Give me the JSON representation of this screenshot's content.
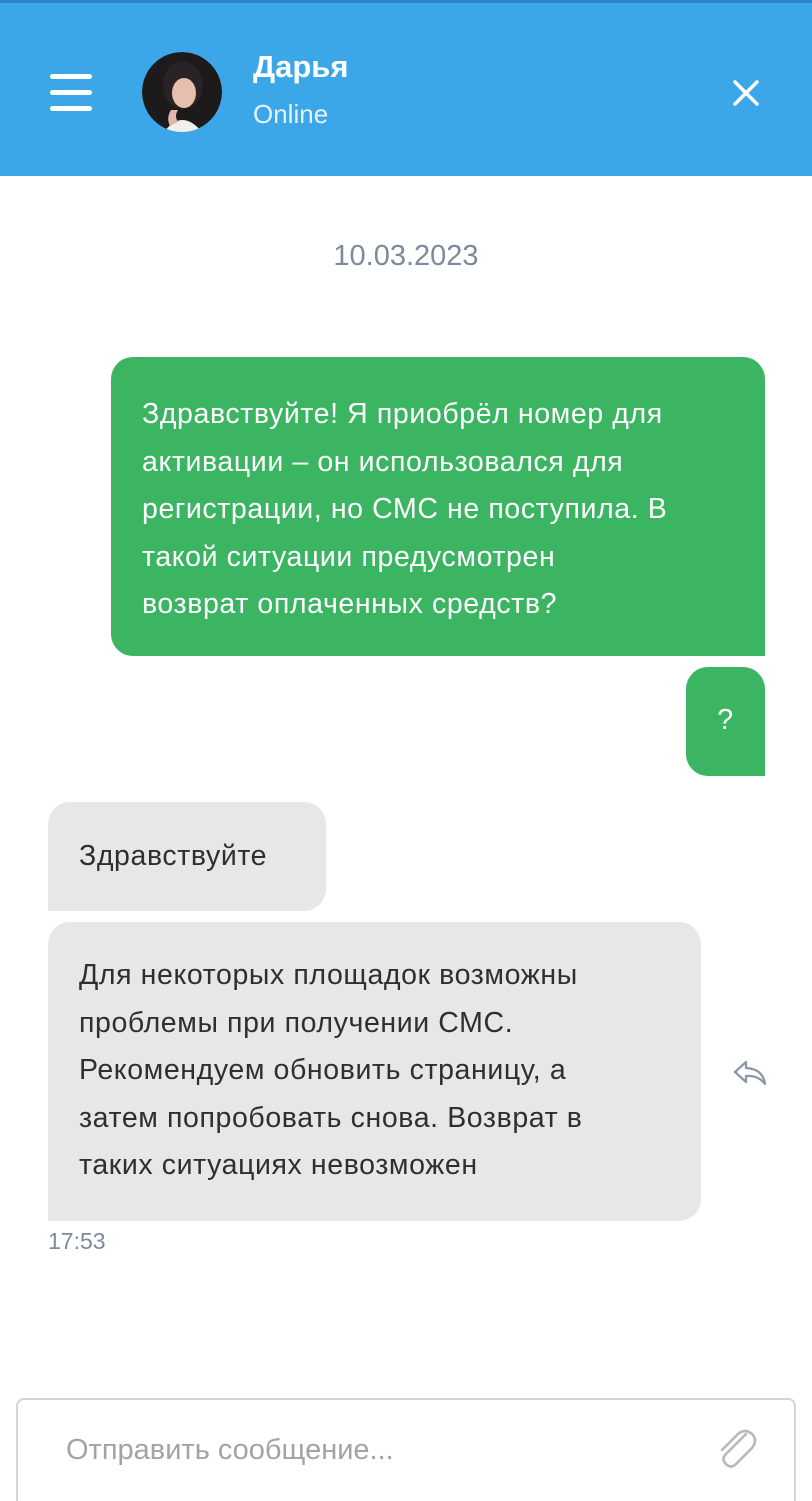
{
  "header": {
    "contact_name": "Дарья",
    "contact_status": "Online",
    "icons": {
      "menu": "hamburger-menu-icon",
      "close": "close-icon"
    },
    "colors": {
      "background": "#3ba7e8",
      "text": "#ffffff"
    }
  },
  "chat": {
    "date_separator": "10.03.2023",
    "messages": [
      {
        "direction": "outgoing",
        "lines": [
          "Здравствуйте! Я приобрёл номер для",
          "активации – он использовался для",
          "регистрации, но СМС не поступила. В",
          "такой ситуации предусмотрен",
          "возврат оплаченных средств?"
        ]
      },
      {
        "direction": "outgoing",
        "text": "?"
      },
      {
        "direction": "incoming",
        "text": "Здравствуйте"
      },
      {
        "direction": "incoming",
        "lines": [
          "Для некоторых площадок возможны",
          "проблемы при получении СМС.",
          "Рекомендуем обновить страницу, а",
          "затем попробовать снова. Возврат в",
          "таких ситуациях невозможен"
        ],
        "time": "17:53"
      }
    ],
    "colors": {
      "outgoing_bubble": "#3cb563",
      "incoming_bubble": "#e7e7e7",
      "meta_text": "#7d8a9c"
    }
  },
  "composer": {
    "placeholder": "Отправить сообщение...",
    "value": "",
    "attach_icon": "paperclip-icon"
  }
}
